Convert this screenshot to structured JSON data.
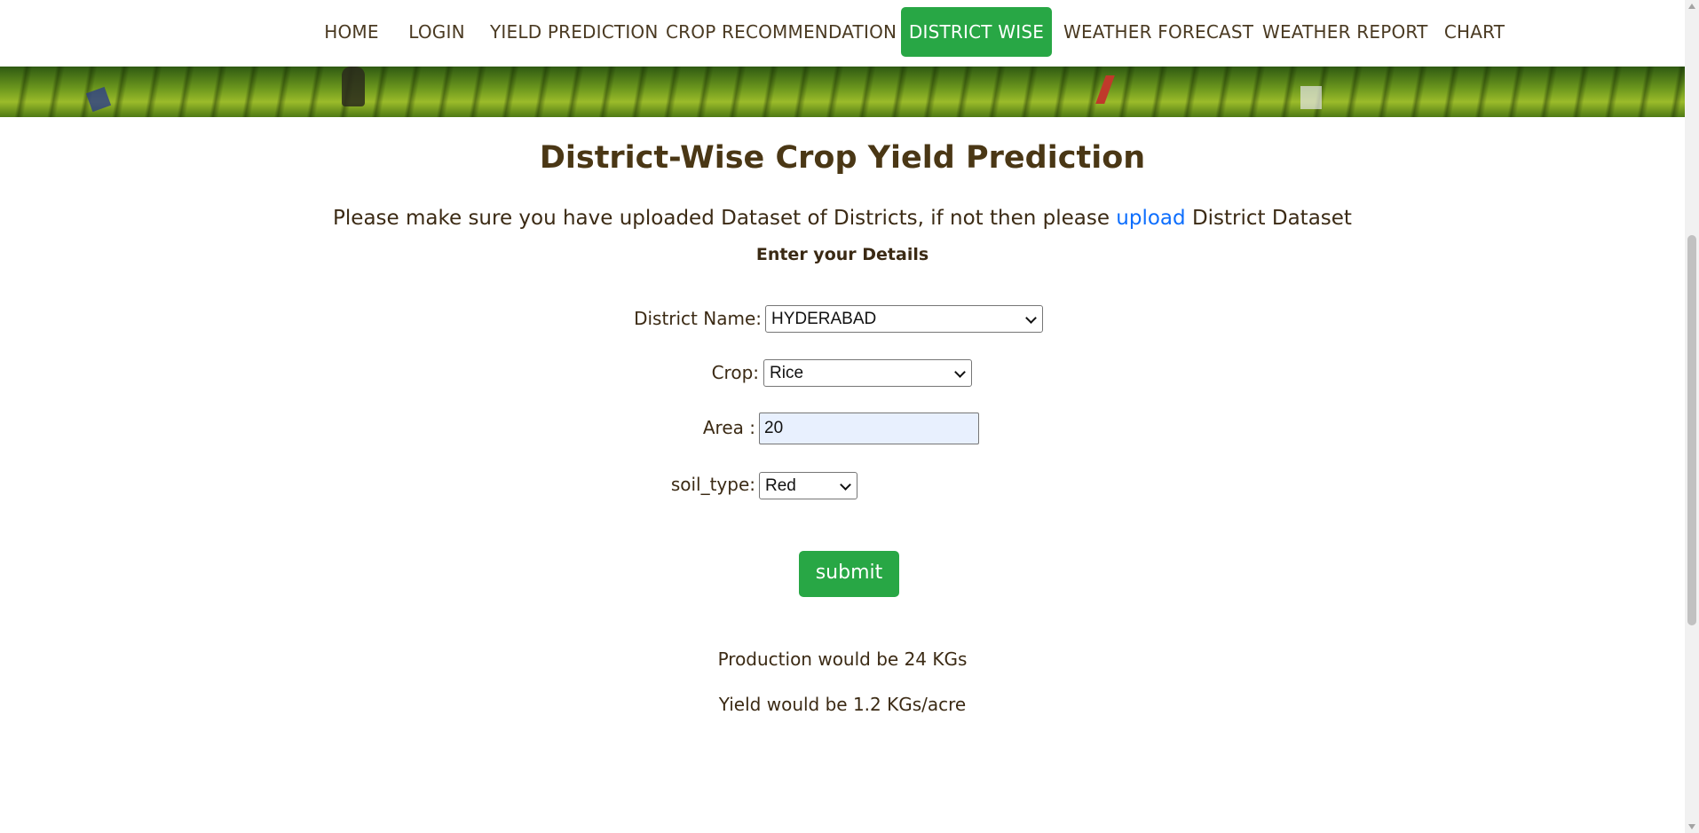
{
  "nav": {
    "items": [
      {
        "label": "HOME",
        "active": false
      },
      {
        "label": "LOGIN",
        "active": false
      },
      {
        "label": "YIELD PREDICTION",
        "active": false
      },
      {
        "label": "CROP RECOMMENDATION",
        "active": false
      },
      {
        "label": "DISTRICT WISE",
        "active": true
      },
      {
        "label": "WEATHER FORECAST",
        "active": false
      },
      {
        "label": "WEATHER REPORT",
        "active": false
      },
      {
        "label": "CHART",
        "active": false
      }
    ]
  },
  "page": {
    "title": "District-Wise Crop Yield Prediction",
    "notice_prefix": "Please make sure you have uploaded Dataset of Districts, if not then please",
    "notice_link": "upload",
    "notice_suffix": "District Dataset",
    "subheading": "Enter your Details"
  },
  "form": {
    "district_label": "District Name:",
    "district_value": "HYDERABAD",
    "crop_label": "Crop:",
    "crop_value": "Rice",
    "area_label": "Area :",
    "area_value": "20",
    "soil_label": "soil_type:",
    "soil_value": "Red",
    "submit_label": "submit"
  },
  "results": {
    "production": "Production would be 24 KGs",
    "yield": "Yield would be 1.2 KGs/acre"
  },
  "colors": {
    "accent": "#28a745",
    "link": "#0d6efd",
    "text": "#3b2a14"
  }
}
